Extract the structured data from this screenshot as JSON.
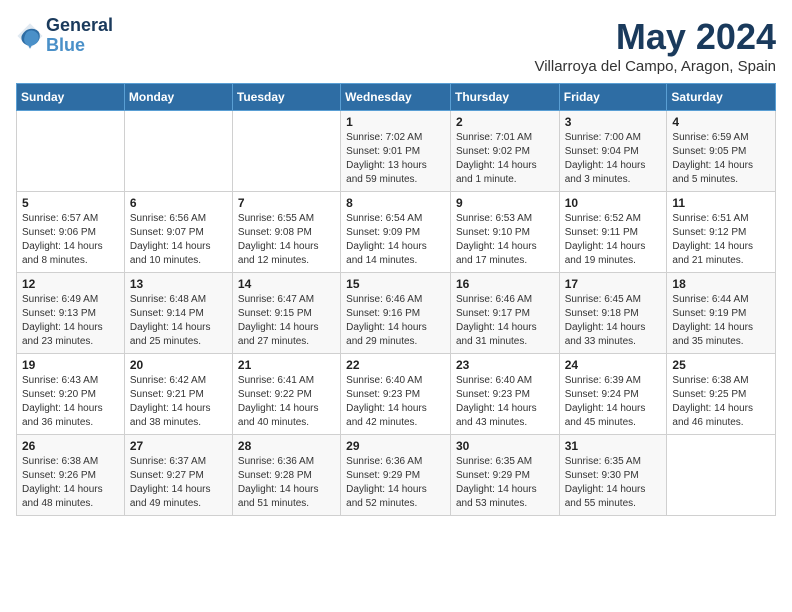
{
  "header": {
    "logo_line1": "General",
    "logo_line2": "Blue",
    "month_title": "May 2024",
    "location": "Villarroya del Campo, Aragon, Spain"
  },
  "days_of_week": [
    "Sunday",
    "Monday",
    "Tuesday",
    "Wednesday",
    "Thursday",
    "Friday",
    "Saturday"
  ],
  "weeks": [
    [
      {
        "day": "",
        "info": ""
      },
      {
        "day": "",
        "info": ""
      },
      {
        "day": "",
        "info": ""
      },
      {
        "day": "1",
        "info": "Sunrise: 7:02 AM\nSunset: 9:01 PM\nDaylight: 13 hours\nand 59 minutes."
      },
      {
        "day": "2",
        "info": "Sunrise: 7:01 AM\nSunset: 9:02 PM\nDaylight: 14 hours\nand 1 minute."
      },
      {
        "day": "3",
        "info": "Sunrise: 7:00 AM\nSunset: 9:04 PM\nDaylight: 14 hours\nand 3 minutes."
      },
      {
        "day": "4",
        "info": "Sunrise: 6:59 AM\nSunset: 9:05 PM\nDaylight: 14 hours\nand 5 minutes."
      }
    ],
    [
      {
        "day": "5",
        "info": "Sunrise: 6:57 AM\nSunset: 9:06 PM\nDaylight: 14 hours\nand 8 minutes."
      },
      {
        "day": "6",
        "info": "Sunrise: 6:56 AM\nSunset: 9:07 PM\nDaylight: 14 hours\nand 10 minutes."
      },
      {
        "day": "7",
        "info": "Sunrise: 6:55 AM\nSunset: 9:08 PM\nDaylight: 14 hours\nand 12 minutes."
      },
      {
        "day": "8",
        "info": "Sunrise: 6:54 AM\nSunset: 9:09 PM\nDaylight: 14 hours\nand 14 minutes."
      },
      {
        "day": "9",
        "info": "Sunrise: 6:53 AM\nSunset: 9:10 PM\nDaylight: 14 hours\nand 17 minutes."
      },
      {
        "day": "10",
        "info": "Sunrise: 6:52 AM\nSunset: 9:11 PM\nDaylight: 14 hours\nand 19 minutes."
      },
      {
        "day": "11",
        "info": "Sunrise: 6:51 AM\nSunset: 9:12 PM\nDaylight: 14 hours\nand 21 minutes."
      }
    ],
    [
      {
        "day": "12",
        "info": "Sunrise: 6:49 AM\nSunset: 9:13 PM\nDaylight: 14 hours\nand 23 minutes."
      },
      {
        "day": "13",
        "info": "Sunrise: 6:48 AM\nSunset: 9:14 PM\nDaylight: 14 hours\nand 25 minutes."
      },
      {
        "day": "14",
        "info": "Sunrise: 6:47 AM\nSunset: 9:15 PM\nDaylight: 14 hours\nand 27 minutes."
      },
      {
        "day": "15",
        "info": "Sunrise: 6:46 AM\nSunset: 9:16 PM\nDaylight: 14 hours\nand 29 minutes."
      },
      {
        "day": "16",
        "info": "Sunrise: 6:46 AM\nSunset: 9:17 PM\nDaylight: 14 hours\nand 31 minutes."
      },
      {
        "day": "17",
        "info": "Sunrise: 6:45 AM\nSunset: 9:18 PM\nDaylight: 14 hours\nand 33 minutes."
      },
      {
        "day": "18",
        "info": "Sunrise: 6:44 AM\nSunset: 9:19 PM\nDaylight: 14 hours\nand 35 minutes."
      }
    ],
    [
      {
        "day": "19",
        "info": "Sunrise: 6:43 AM\nSunset: 9:20 PM\nDaylight: 14 hours\nand 36 minutes."
      },
      {
        "day": "20",
        "info": "Sunrise: 6:42 AM\nSunset: 9:21 PM\nDaylight: 14 hours\nand 38 minutes."
      },
      {
        "day": "21",
        "info": "Sunrise: 6:41 AM\nSunset: 9:22 PM\nDaylight: 14 hours\nand 40 minutes."
      },
      {
        "day": "22",
        "info": "Sunrise: 6:40 AM\nSunset: 9:23 PM\nDaylight: 14 hours\nand 42 minutes."
      },
      {
        "day": "23",
        "info": "Sunrise: 6:40 AM\nSunset: 9:23 PM\nDaylight: 14 hours\nand 43 minutes."
      },
      {
        "day": "24",
        "info": "Sunrise: 6:39 AM\nSunset: 9:24 PM\nDaylight: 14 hours\nand 45 minutes."
      },
      {
        "day": "25",
        "info": "Sunrise: 6:38 AM\nSunset: 9:25 PM\nDaylight: 14 hours\nand 46 minutes."
      }
    ],
    [
      {
        "day": "26",
        "info": "Sunrise: 6:38 AM\nSunset: 9:26 PM\nDaylight: 14 hours\nand 48 minutes."
      },
      {
        "day": "27",
        "info": "Sunrise: 6:37 AM\nSunset: 9:27 PM\nDaylight: 14 hours\nand 49 minutes."
      },
      {
        "day": "28",
        "info": "Sunrise: 6:36 AM\nSunset: 9:28 PM\nDaylight: 14 hours\nand 51 minutes."
      },
      {
        "day": "29",
        "info": "Sunrise: 6:36 AM\nSunset: 9:29 PM\nDaylight: 14 hours\nand 52 minutes."
      },
      {
        "day": "30",
        "info": "Sunrise: 6:35 AM\nSunset: 9:29 PM\nDaylight: 14 hours\nand 53 minutes."
      },
      {
        "day": "31",
        "info": "Sunrise: 6:35 AM\nSunset: 9:30 PM\nDaylight: 14 hours\nand 55 minutes."
      },
      {
        "day": "",
        "info": ""
      }
    ]
  ]
}
